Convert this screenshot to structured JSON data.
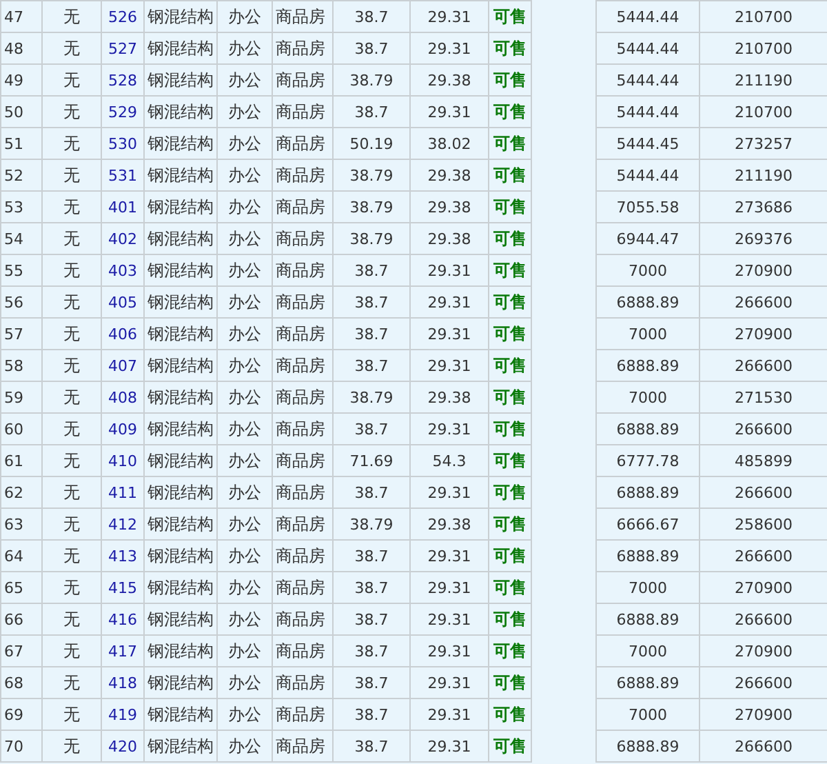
{
  "table": {
    "rows": [
      {
        "cells": [
          "47",
          "无",
          "526",
          "钢混结构",
          "办公",
          "商品房",
          "38.7",
          "29.31",
          "可售",
          "5444.44",
          "210700"
        ]
      },
      {
        "cells": [
          "48",
          "无",
          "527",
          "钢混结构",
          "办公",
          "商品房",
          "38.7",
          "29.31",
          "可售",
          "5444.44",
          "210700"
        ]
      },
      {
        "cells": [
          "49",
          "无",
          "528",
          "钢混结构",
          "办公",
          "商品房",
          "38.79",
          "29.38",
          "可售",
          "5444.44",
          "211190"
        ]
      },
      {
        "cells": [
          "50",
          "无",
          "529",
          "钢混结构",
          "办公",
          "商品房",
          "38.7",
          "29.31",
          "可售",
          "5444.44",
          "210700"
        ]
      },
      {
        "cells": [
          "51",
          "无",
          "530",
          "钢混结构",
          "办公",
          "商品房",
          "50.19",
          "38.02",
          "可售",
          "5444.45",
          "273257"
        ]
      },
      {
        "cells": [
          "52",
          "无",
          "531",
          "钢混结构",
          "办公",
          "商品房",
          "38.79",
          "29.38",
          "可售",
          "5444.44",
          "211190"
        ]
      },
      {
        "cells": [
          "53",
          "无",
          "401",
          "钢混结构",
          "办公",
          "商品房",
          "38.79",
          "29.38",
          "可售",
          "7055.58",
          "273686"
        ]
      },
      {
        "cells": [
          "54",
          "无",
          "402",
          "钢混结构",
          "办公",
          "商品房",
          "38.79",
          "29.38",
          "可售",
          "6944.47",
          "269376"
        ]
      },
      {
        "cells": [
          "55",
          "无",
          "403",
          "钢混结构",
          "办公",
          "商品房",
          "38.7",
          "29.31",
          "可售",
          "7000",
          "270900"
        ]
      },
      {
        "cells": [
          "56",
          "无",
          "405",
          "钢混结构",
          "办公",
          "商品房",
          "38.7",
          "29.31",
          "可售",
          "6888.89",
          "266600"
        ]
      },
      {
        "cells": [
          "57",
          "无",
          "406",
          "钢混结构",
          "办公",
          "商品房",
          "38.7",
          "29.31",
          "可售",
          "7000",
          "270900"
        ]
      },
      {
        "cells": [
          "58",
          "无",
          "407",
          "钢混结构",
          "办公",
          "商品房",
          "38.7",
          "29.31",
          "可售",
          "6888.89",
          "266600"
        ]
      },
      {
        "cells": [
          "59",
          "无",
          "408",
          "钢混结构",
          "办公",
          "商品房",
          "38.79",
          "29.38",
          "可售",
          "7000",
          "271530"
        ]
      },
      {
        "cells": [
          "60",
          "无",
          "409",
          "钢混结构",
          "办公",
          "商品房",
          "38.7",
          "29.31",
          "可售",
          "6888.89",
          "266600"
        ]
      },
      {
        "cells": [
          "61",
          "无",
          "410",
          "钢混结构",
          "办公",
          "商品房",
          "71.69",
          "54.3",
          "可售",
          "6777.78",
          "485899"
        ]
      },
      {
        "cells": [
          "62",
          "无",
          "411",
          "钢混结构",
          "办公",
          "商品房",
          "38.7",
          "29.31",
          "可售",
          "6888.89",
          "266600"
        ]
      },
      {
        "cells": [
          "63",
          "无",
          "412",
          "钢混结构",
          "办公",
          "商品房",
          "38.79",
          "29.38",
          "可售",
          "6666.67",
          "258600"
        ]
      },
      {
        "cells": [
          "64",
          "无",
          "413",
          "钢混结构",
          "办公",
          "商品房",
          "38.7",
          "29.31",
          "可售",
          "6888.89",
          "266600"
        ]
      },
      {
        "cells": [
          "65",
          "无",
          "415",
          "钢混结构",
          "办公",
          "商品房",
          "38.7",
          "29.31",
          "可售",
          "7000",
          "270900"
        ]
      },
      {
        "cells": [
          "66",
          "无",
          "416",
          "钢混结构",
          "办公",
          "商品房",
          "38.7",
          "29.31",
          "可售",
          "6888.89",
          "266600"
        ]
      },
      {
        "cells": [
          "67",
          "无",
          "417",
          "钢混结构",
          "办公",
          "商品房",
          "38.7",
          "29.31",
          "可售",
          "7000",
          "270900"
        ]
      },
      {
        "cells": [
          "68",
          "无",
          "418",
          "钢混结构",
          "办公",
          "商品房",
          "38.7",
          "29.31",
          "可售",
          "6888.89",
          "266600"
        ]
      },
      {
        "cells": [
          "69",
          "无",
          "419",
          "钢混结构",
          "办公",
          "商品房",
          "38.7",
          "29.31",
          "可售",
          "7000",
          "270900"
        ]
      },
      {
        "cells": [
          "70",
          "无",
          "420",
          "钢混结构",
          "办公",
          "商品房",
          "38.7",
          "29.31",
          "可售",
          "6888.89",
          "266600"
        ]
      }
    ]
  }
}
